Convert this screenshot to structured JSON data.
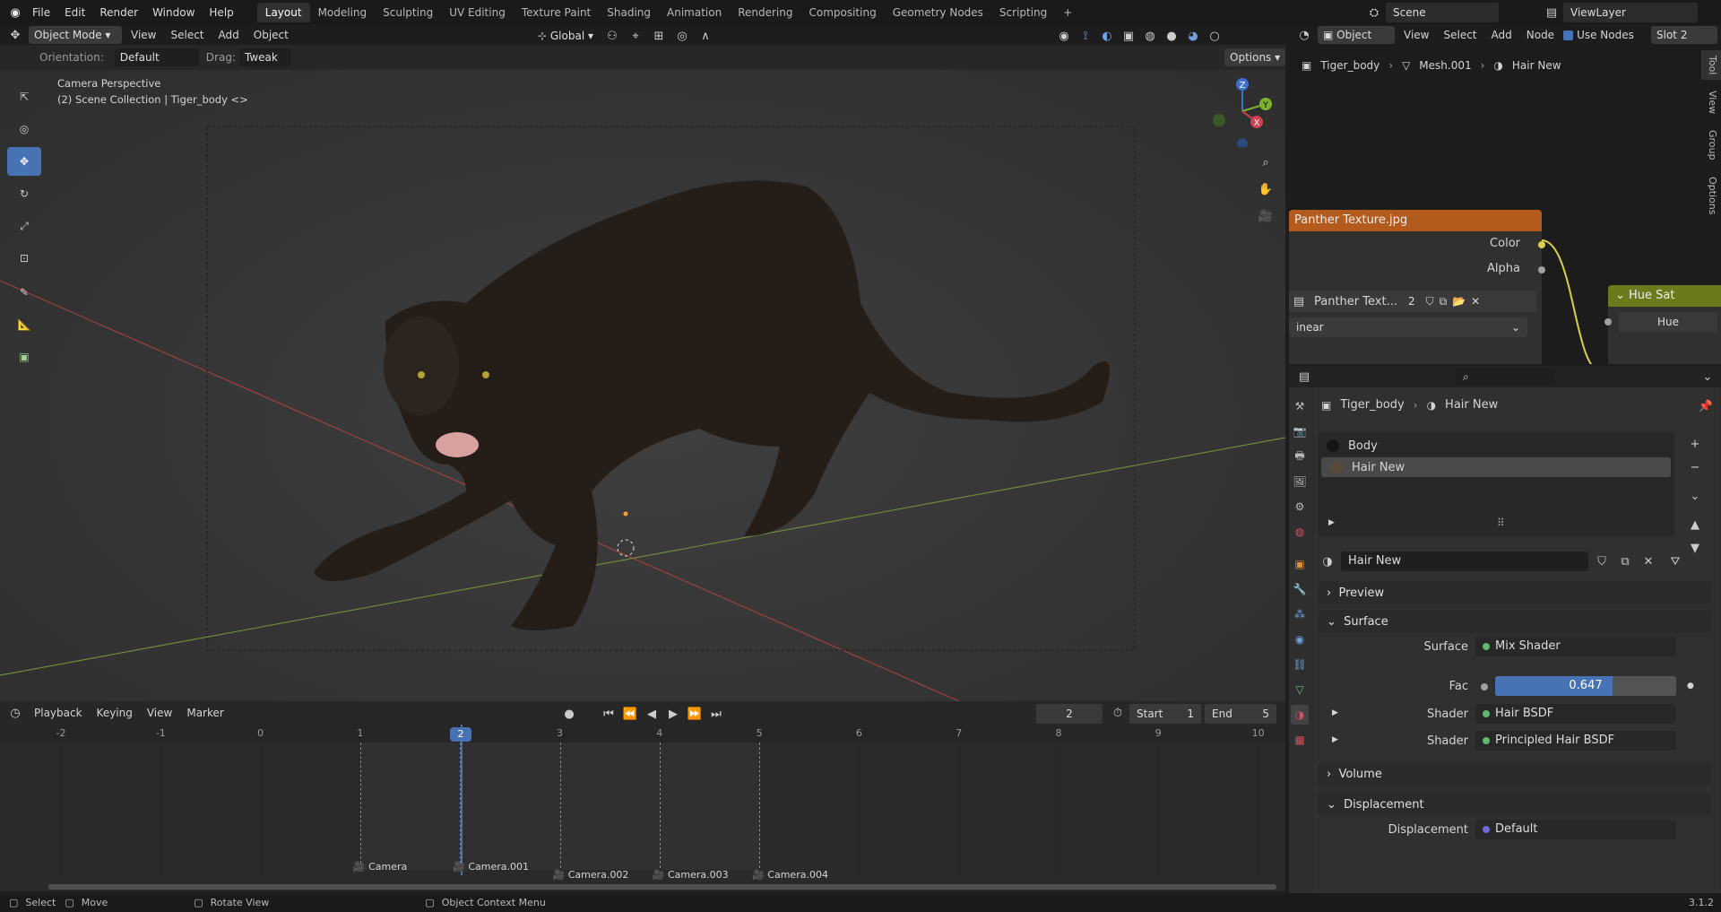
{
  "topbar": {
    "menus": [
      "File",
      "Edit",
      "Render",
      "Window",
      "Help"
    ],
    "workspaces": [
      "Layout",
      "Modeling",
      "Sculpting",
      "UV Editing",
      "Texture Paint",
      "Shading",
      "Animation",
      "Rendering",
      "Compositing",
      "Geometry Nodes",
      "Scripting"
    ],
    "active_workspace": "Layout",
    "add_tab": "+",
    "scene_label": "Scene",
    "viewlayer_label": "ViewLayer"
  },
  "viewport_header": {
    "mode": "Object Mode",
    "menus": [
      "View",
      "Select",
      "Add",
      "Object"
    ],
    "transform_orientation": "Global",
    "options": "Options"
  },
  "tool_settings": {
    "orientation_label": "Orientation:",
    "orientation_value": "Default",
    "drag_label": "Drag:",
    "drag_value": "Tweak"
  },
  "viewport": {
    "overlay_line1": "Camera Perspective",
    "overlay_line2": "(2) Scene Collection | Tiger_body <>",
    "gizmo_axes": [
      "Z",
      "Y",
      "X"
    ]
  },
  "node_editor": {
    "mode": "Object",
    "menus": [
      "View",
      "Select",
      "Add",
      "Node"
    ],
    "use_nodes_label": "Use Nodes",
    "slot": "Slot 2",
    "breadcrumb": [
      "Tiger_body",
      "Mesh.001",
      "Hair New"
    ],
    "side_tabs": [
      "Tool",
      "View",
      "Group",
      "Options"
    ],
    "image_node": {
      "title": "Panther Texture.jpg",
      "outputs": [
        "Color",
        "Alpha"
      ],
      "image_name": "Panther Text...",
      "users": "2",
      "interpolation": "inear"
    },
    "hue_node": {
      "title": "Hue Sat",
      "input": "Hue"
    }
  },
  "properties": {
    "search_placeholder": "",
    "breadcrumb": [
      "Tiger_body",
      "Hair New"
    ],
    "material_slots": [
      "Body",
      "Hair New"
    ],
    "selected_slot": "Hair New",
    "material_name": "Hair New",
    "sections": {
      "preview": "Preview",
      "surface": "Surface",
      "volume": "Volume",
      "displacement": "Displacement"
    },
    "surface_rows": [
      {
        "label": "Surface",
        "value": "Mix Shader",
        "dot": "#5fb86e"
      },
      {
        "label": "Fac",
        "value": "0.647",
        "fraction": 0.647
      },
      {
        "label": "Shader",
        "value": "Hair BSDF",
        "dot": "#5fb86e"
      },
      {
        "label": "Shader",
        "value": "Principled Hair BSDF",
        "dot": "#5fb86e"
      }
    ],
    "displacement_row": {
      "label": "Displacement",
      "value": "Default",
      "dot": "#6b6bd6"
    }
  },
  "timeline": {
    "menus": [
      "Playback",
      "Keying",
      "View",
      "Marker"
    ],
    "current_frame": "2",
    "start_label": "Start",
    "start_value": "1",
    "end_label": "End",
    "end_value": "5",
    "ruler": [
      "-2",
      "-1",
      "0",
      "1",
      "2",
      "3",
      "4",
      "5",
      "6",
      "7",
      "8",
      "9",
      "10"
    ],
    "current_frame_badge": "2",
    "markers": [
      "Camera",
      "Camera.001",
      "Camera.002",
      "Camera.003",
      "Camera.004"
    ]
  },
  "statusbar": {
    "items": [
      "Select",
      "Move",
      "Rotate View",
      "Object Context Menu"
    ],
    "version": "3.1.2"
  },
  "colors": {
    "accent": "#4772b3",
    "image_node_header": "#b35b1d",
    "hue_node_header": "#6b7a1a",
    "fac_fill": "#4772b3"
  }
}
